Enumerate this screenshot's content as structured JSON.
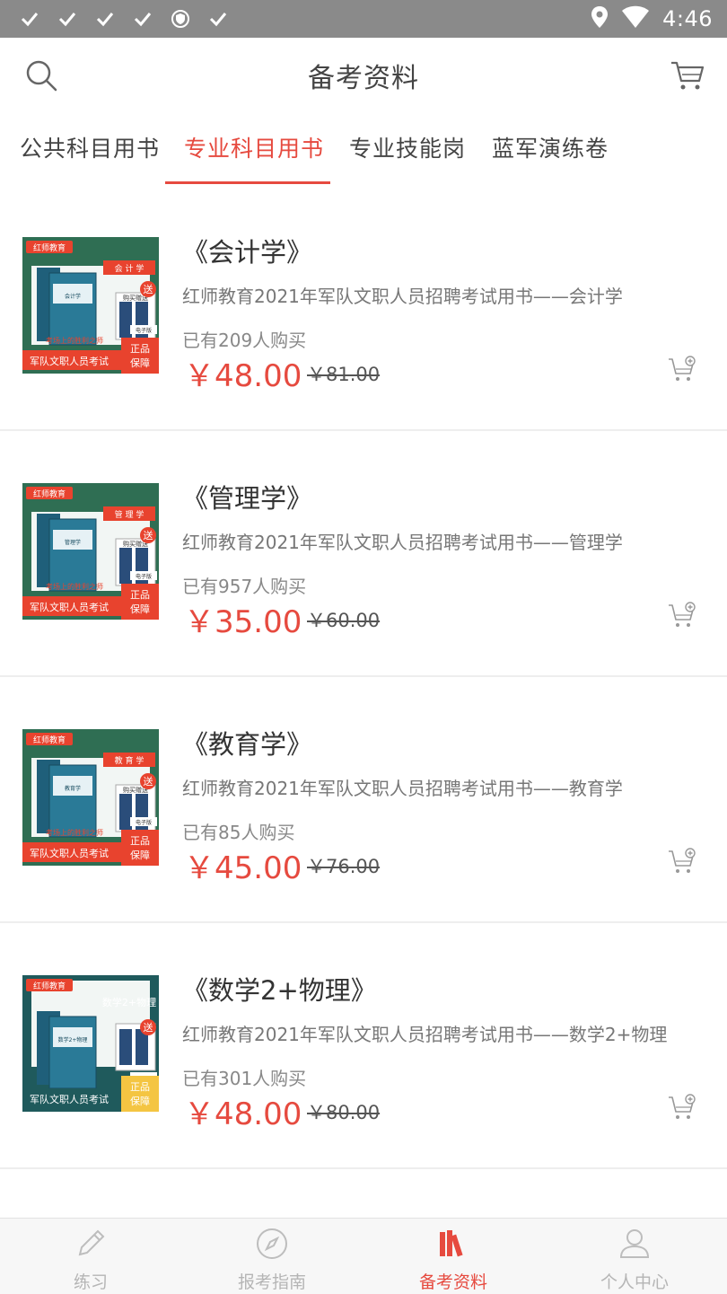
{
  "status_bar": {
    "time": "4:46",
    "left_icons": [
      "check-icon",
      "check-icon",
      "check-icon",
      "check-icon",
      "shield-icon",
      "check-icon"
    ],
    "right_icons": [
      "location-icon",
      "wifi-icon"
    ]
  },
  "header": {
    "title": "备考资料",
    "icons": {
      "search": "search-icon",
      "cart": "cart-icon"
    }
  },
  "tabs": [
    {
      "label": "公共科目用书",
      "active": false
    },
    {
      "label": "专业科目用书",
      "active": true
    },
    {
      "label": "专业技能岗",
      "active": false
    },
    {
      "label": "蓝军演练卷",
      "active": false
    }
  ],
  "products": [
    {
      "title": "《会计学》",
      "description": "红师教育2021年军队文职人员招聘考试用书——会计学",
      "sales": "已有209人购买",
      "price": "￥48.00",
      "original_price": "￥81.00",
      "cover": {
        "subject": "会 计 学",
        "book_label": "会计学",
        "slogan": "考场上的胜利之师",
        "bottom": "军队文职人员考试",
        "badge": "正品保障",
        "gift": "送",
        "gift_label": "购买赠送",
        "edition": "电子版",
        "style": "green"
      }
    },
    {
      "title": "《管理学》",
      "description": "红师教育2021年军队文职人员招聘考试用书——管理学",
      "sales": "已有957人购买",
      "price": "￥35.00",
      "original_price": "￥60.00",
      "cover": {
        "subject": "管 理 学",
        "book_label": "管理学",
        "slogan": "考场上的胜利之师",
        "bottom": "军队文职人员考试",
        "badge": "正品保障",
        "gift": "送",
        "gift_label": "购买赠送",
        "edition": "电子版",
        "style": "green"
      }
    },
    {
      "title": "《教育学》",
      "description": "红师教育2021年军队文职人员招聘考试用书——教育学",
      "sales": "已有85人购买",
      "price": "￥45.00",
      "original_price": "￥76.00",
      "cover": {
        "subject": "教 育 学",
        "book_label": "教育学",
        "slogan": "考场上的胜利之师",
        "bottom": "军队文职人员考试",
        "badge": "正品保障",
        "gift": "送",
        "gift_label": "购买赠送",
        "edition": "电子版",
        "style": "green"
      }
    },
    {
      "title": "《数学2+物理》",
      "description": "红师教育2021年军队文职人员招聘考试用书——数学2+物理",
      "sales": "已有301人购买",
      "price": "￥48.00",
      "original_price": "￥80.00",
      "cover": {
        "subject": "数学2+物理",
        "book_label": "数学2+物理",
        "slogan": "",
        "bottom": "军队文职人员考试",
        "badge": "正品保障",
        "gift": "送",
        "gift_label": "",
        "edition": "",
        "style": "teal"
      }
    }
  ],
  "bottom_nav": [
    {
      "label": "练习",
      "icon": "pencil-icon",
      "active": false
    },
    {
      "label": "报考指南",
      "icon": "compass-icon",
      "active": false
    },
    {
      "label": "备考资料",
      "icon": "books-icon",
      "active": true
    },
    {
      "label": "个人中心",
      "icon": "user-icon",
      "active": false
    }
  ],
  "colors": {
    "accent": "#e64a3f",
    "status_bar": "#8a8a8a",
    "cover_green": "#2f6e53",
    "cover_teal": "#1f5a5c",
    "cover_red": "#e8432e"
  }
}
